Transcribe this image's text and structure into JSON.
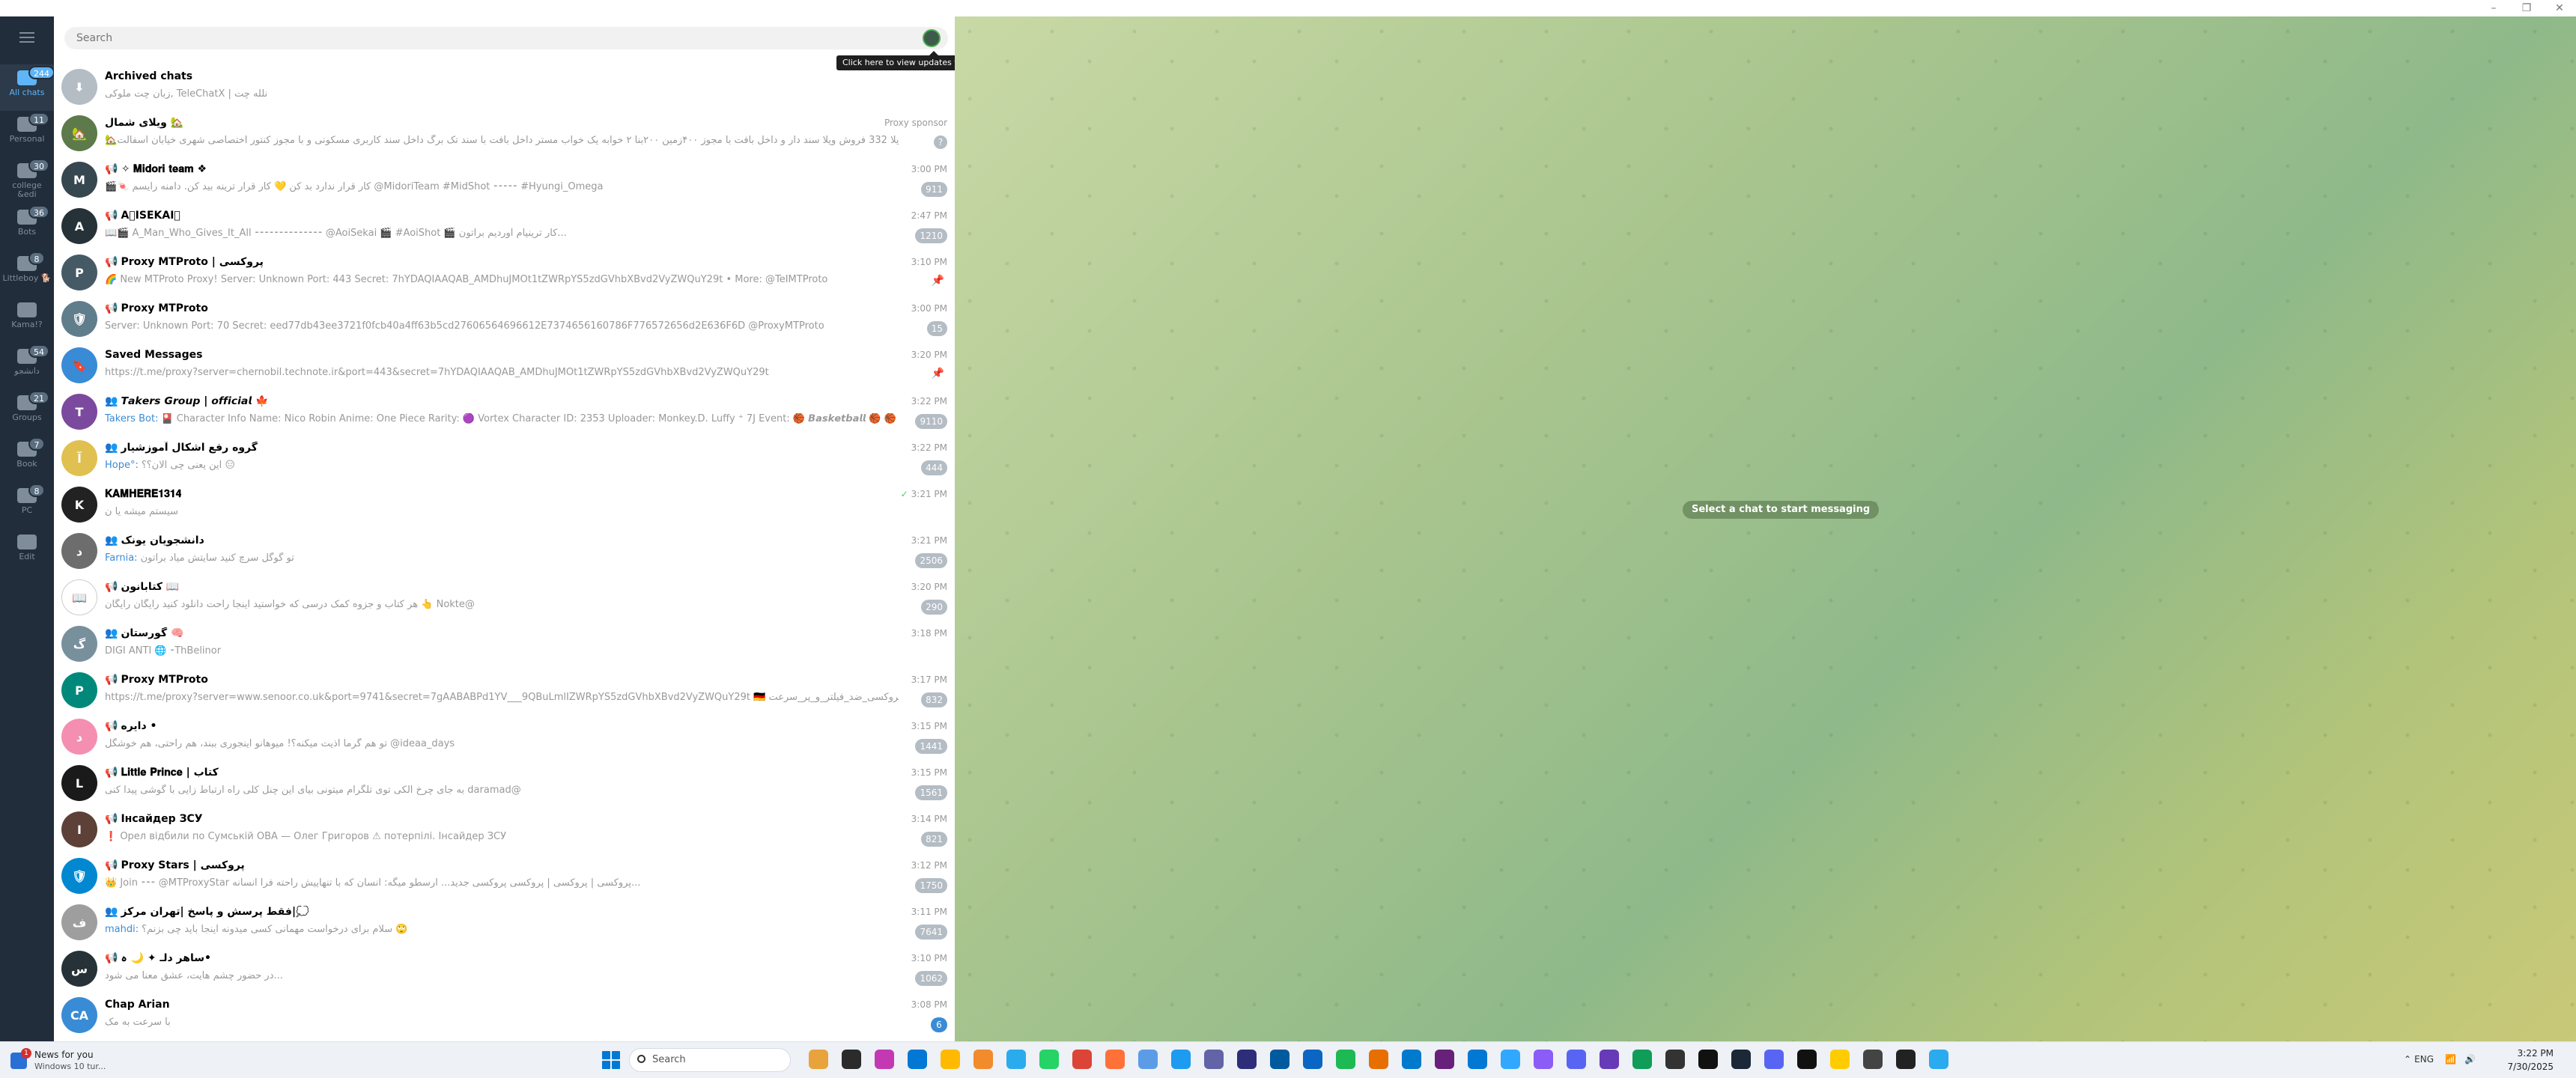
{
  "window": {
    "controls": [
      "–",
      "❐",
      "✕"
    ]
  },
  "folders": [
    {
      "label": "All chats",
      "badge": "244",
      "active": true
    },
    {
      "label": "Personal",
      "badge": "11"
    },
    {
      "label": "college &edi",
      "badge": "30"
    },
    {
      "label": "Bots",
      "badge": "36"
    },
    {
      "label": "Littleboy 🐕",
      "badge": "8"
    },
    {
      "label": "Kama!?",
      "badge": ""
    },
    {
      "label": "دانشجو",
      "badge": "54"
    },
    {
      "label": "Groups",
      "badge": "21"
    },
    {
      "label": "Book",
      "badge": "7"
    },
    {
      "label": "PC",
      "badge": "8"
    },
    {
      "label": "Edit",
      "badge": ""
    }
  ],
  "search": {
    "placeholder": "Search"
  },
  "tooltip": {
    "text": "Click here to view updates from ایمان"
  },
  "chats": [
    {
      "title": "Archived chats",
      "type": "",
      "time": "",
      "snippet": "زبان چت ملوکی, TeleChatX | نلله چت",
      "sender": "",
      "badge": "",
      "avatar_color": "#b4bcc4",
      "avatar_text": "⬇"
    },
    {
      "title": "ویلای شمال 🏡",
      "type": "",
      "time": "Proxy sponsor",
      "snippet": "🏡ویلا 332 فروش ویلا سند دار و داخل بافت با مجوز ۴۰۰زمین ۲۰۰بنا ۲ خوابه یک خواب مستر  داخل بافت با سند تک برگ داخل سند کاربری مسکونی و با مجوز کنتور اختصاصی  شهری خیابان اسفالت",
      "sender": "",
      "badge": "",
      "avatar_color": "#5c7a4a",
      "avatar_text": "🏡"
    },
    {
      "title": "𝐌𝐢𝐝𝐨𝐫𝐢 𝐭𝐞𝐚𝐦 ❖",
      "type": "📢 ✧",
      "time": "3:00 PM",
      "snippet": "🎬🍬 کار قرار ندارد بد کن 💛 کار قرار ترینه بید کن. دامنه رایسم @MidoriTeam #MidShot ⁃⁃⁃⁃⁃ #Hyungi_Omega",
      "sender": "",
      "badge": "911",
      "avatar_color": "#37474f",
      "avatar_text": "M"
    },
    {
      "title": "A⃟ISEKAI⃟",
      "type": "📢",
      "time": "2:47 PM",
      "snippet": "📖🎬 A_Man_Who_Gives_It_All ⁃⁃⁃⁃⁃⁃⁃⁃⁃⁃⁃⁃⁃⁃ @AoiSekai 🎬 #AoiShot 🎬 کار ترینیام اوردیم براتون...",
      "sender": "",
      "badge": "1210",
      "avatar_color": "#263238",
      "avatar_text": "A"
    },
    {
      "title": "Proxy MTProto | پروکسی",
      "type": "📢",
      "time": "3:10 PM",
      "snippet": "🌈 New MTProto Proxy! Server: Unknown Port: 443 Secret: 7hYDAQIAAQAB_AMDhuJMOt1tZWRpYS5zdGVhbXBvd2VyZWQuY29t • More: @TeIMTProto",
      "sender": "",
      "badge": "pin",
      "avatar_color": "#455a64",
      "avatar_text": "P"
    },
    {
      "title": "Proxy MTProto",
      "type": "📢",
      "time": "3:00 PM",
      "snippet": "Server: Unknown  Port: 70 Secret: eed77db43ee3721f0fcb40a4ff63b5cd27606564696612E7374656160786F776572656d2E636F6D @ProxyMTProto",
      "sender": "",
      "badge": "15",
      "avatar_color": "#607d8b",
      "avatar_text": "🛡"
    },
    {
      "title": "Saved Messages",
      "type": "",
      "time": "3:20 PM",
      "snippet": "https://t.me/proxy?server=chernobil.technote.ir&port=443&secret=7hYDAQIAAQAB_AMDhuJMOt1tZWRpYS5zdGVhbXBvd2VyZWQuY29t",
      "sender": "",
      "badge": "pin",
      "avatar_color": "#3a8bd5",
      "avatar_text": "🔖"
    },
    {
      "title": "𝙏𝙖𝙠𝙚𝙧𝙨 𝙂𝙧𝙤𝙪𝙥 | 𝙤𝙛𝙛𝙞𝙘𝙞𝙖𝙡 🍁",
      "type": "👥",
      "time": "3:22 PM",
      "snippet": "🎴 Character Info  Name: Nico Robin Anime: One Piece Rarity: 🟣 Vortex Character ID: 2353 Uploader: Monkey.D. Luffy ⁺ 7J Event: 🏀 𝘽𝙖𝙨𝙠𝙚𝙩𝙗𝙖𝙡𝙡 🏀 🏀 ⁃⁃⁃⁃⁃⁃⁃⁃⁃⁃⁃",
      "sender": "Takers Bot:",
      "badge": "9110",
      "avatar_color": "#7b4a9e",
      "avatar_text": "T"
    },
    {
      "title": "گروه رفع اشکال آموزشیار",
      "type": "👥",
      "time": "3:22 PM",
      "snippet": "این یعنی چی الان؟؟ 😑",
      "sender": "Hope°:",
      "badge": "444",
      "avatar_color": "#e0c050",
      "avatar_text": "آ"
    },
    {
      "title": "𝐊𝐀𝐌𝐇𝐄𝐑𝐄𝟏𝟑𝟏𝟒",
      "type": "",
      "time": "3:21 PM",
      "snippet": "سیستم میشه یا ن",
      "sender": "",
      "badge": "",
      "check": true,
      "avatar_color": "#222222",
      "avatar_text": "K"
    },
    {
      "title": "دانشجویان یونک",
      "type": "👥",
      "time": "3:21 PM",
      "snippet": "تو گوگل سرچ کنید سایتش میاد براتون",
      "sender": "Farnia:",
      "badge": "2506",
      "avatar_color": "#6d6d6d",
      "avatar_text": "د"
    },
    {
      "title": "کتابانون 📖",
      "type": "📢",
      "time": "3:20 PM",
      "snippet": "هر کتاب و جزوه کمک درسی که خواستید اینجا راحت دانلود کنید رایگان رایگان 👆 Nokte@",
      "sender": "",
      "badge": "290",
      "avatar_color": "#ffffff",
      "avatar_text": "📖"
    },
    {
      "title": "گورستان 🧠",
      "type": "👥",
      "time": "3:18 PM",
      "snippet": "DIGI ANTI 🌐 ⁃ThBelinor",
      "sender": "",
      "badge": "",
      "avatar_color": "#78909c",
      "avatar_text": "گ"
    },
    {
      "title": "Proxy MTProto",
      "type": "📢",
      "time": "3:17 PM",
      "snippet": "https://t.me/proxy?server=www.senoor.co.uk&port=9741&secret=7gAABABPd1YV___9QBuLmlIZWRpYS5zdGVhbXBvd2VyZWQuY29t 🇩🇪 پروکسی_ضد_فیلتر_و_پر_سرعت ✅ 🔒",
      "sender": "",
      "badge": "832",
      "avatar_color": "#00897b",
      "avatar_text": "P"
    },
    {
      "title": "دایره •",
      "type": "📢",
      "time": "3:15 PM",
      "snippet": "تو هم گرما اذیت میکنه؟! میوهانو اینجوری ببند، هم راحتی، هم خوشگل @ideaa_days",
      "sender": "",
      "badge": "1441",
      "avatar_color": "#f48fb1",
      "avatar_text": "د"
    },
    {
      "title": "𝐋𝐢𝐭𝐭𝐥𝐞 𝐏𝐫𝐢𝐧𝐜𝐞 | کتاب",
      "type": "📢",
      "time": "3:15 PM",
      "snippet": "به جای چرخ الکی توی تلگرام میتونی بیای این چنل کلی راه ارتباط زایی با گوشی پیدا کنی daramad@",
      "sender": "",
      "badge": "1561",
      "avatar_color": "#1a1a1a",
      "avatar_text": "L"
    },
    {
      "title": "Інсайдер ЗСУ",
      "type": "📢",
      "time": "3:14 PM",
      "snippet": "❗️ Орел відбили по Сумській ОВА — Олег Григоров  ⚠ потерпілі. Інсайдер ЗСУ",
      "sender": "",
      "badge": "821",
      "avatar_color": "#5d4037",
      "avatar_text": "І"
    },
    {
      "title": "Proxy Stars | پروکسی",
      "type": "📢",
      "time": "3:12 PM",
      "snippet": "👑 Join ⁃⁃⁃ @MTProxyStar  پروکسی | پروکسی | پروکسی پروکسی جدید... ارسطو میگه: انسان که با تنهاییش راحته فرا انسانه...",
      "sender": "",
      "badge": "1750",
      "avatar_color": "#0288d1",
      "avatar_text": "🛡"
    },
    {
      "title": "فقط پرسش و پاسخ |تهران مرکز|💭",
      "type": "👥",
      "time": "3:11 PM",
      "snippet": "سلام برای درخواست مهمانی کسی میدونه اینجا باید چی بزنم؟ 🙄",
      "sender": "mahdi:",
      "badge": "7641",
      "avatar_color": "#9e9e9e",
      "avatar_text": "ف"
    },
    {
      "title": "ساهر دلـ ✦ 🌙 ہ•",
      "type": "📢",
      "time": "3:10 PM",
      "snippet": "در حضور چشم هایت، عشق معنا می شود...",
      "sender": "",
      "badge": "1062",
      "avatar_color": "#263238",
      "avatar_text": "س"
    },
    {
      "title": "Chap Arian",
      "type": "",
      "time": "3:08 PM",
      "snippet": "با سرعت به مک",
      "sender": "",
      "badge": "6",
      "badge_blue": true,
      "avatar_color": "#3a8bd5",
      "avatar_text": "CA"
    }
  ],
  "chat_area": {
    "empty_text": "Select a chat to start messaging"
  },
  "taskbar": {
    "weather_line1": "News for you",
    "weather_line2": "Windows 10 tur...",
    "weather_badge": "1",
    "search_label": "Search",
    "time": "3:22 PM",
    "date": "7/30/2025",
    "tray_lang": "ENG"
  }
}
